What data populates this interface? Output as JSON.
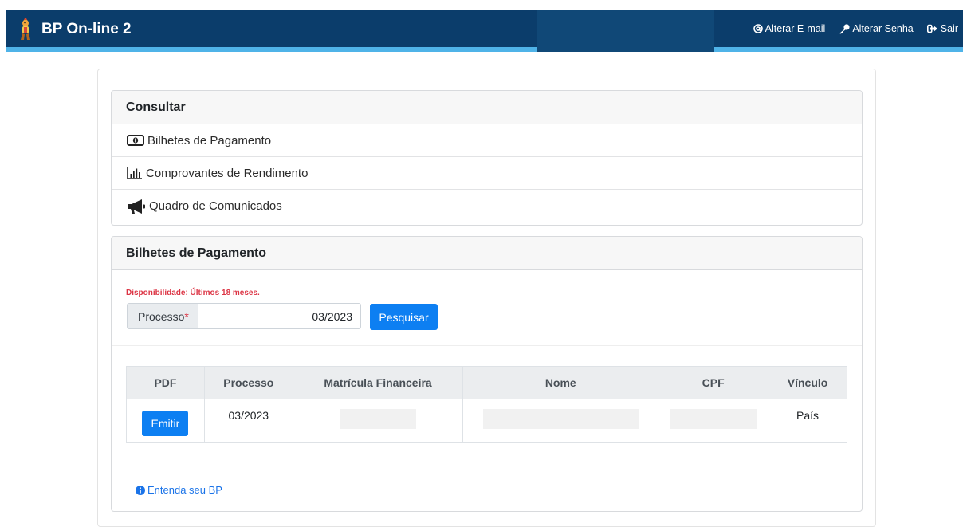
{
  "app": {
    "title": "BP On-line 2"
  },
  "nav": {
    "change_email": "Alterar E-mail",
    "change_password": "Alterar Senha",
    "logout": "Sair"
  },
  "consultar": {
    "title": "Consultar",
    "items": [
      {
        "label": "Bilhetes de Pagamento",
        "icon": "money-bill-icon"
      },
      {
        "label": "Comprovantes de Rendimento",
        "icon": "bar-chart-icon"
      },
      {
        "label": "Quadro de Comunicados",
        "icon": "bullhorn-icon"
      }
    ]
  },
  "bilhetes": {
    "title": "Bilhetes de Pagamento",
    "availability": "Disponibilidade: Últimos 18 meses.",
    "processo_label": "Processo",
    "required_mark": "*",
    "processo_value": "03/2023",
    "search_label": "Pesquisar",
    "table": {
      "headers": [
        "PDF",
        "Processo",
        "Matrícula Financeira",
        "Nome",
        "CPF",
        "Vínculo"
      ],
      "rows": [
        {
          "button": "Emitir",
          "processo": "03/2023",
          "vinculo": "País"
        }
      ]
    },
    "understand_link": "Entenda seu BP"
  },
  "colors": {
    "navbar": "#0b3d6b",
    "accent": "#4fb3e8",
    "primary": "#0d7ff2",
    "required": "#dc3545",
    "link": "#1a73e8"
  }
}
